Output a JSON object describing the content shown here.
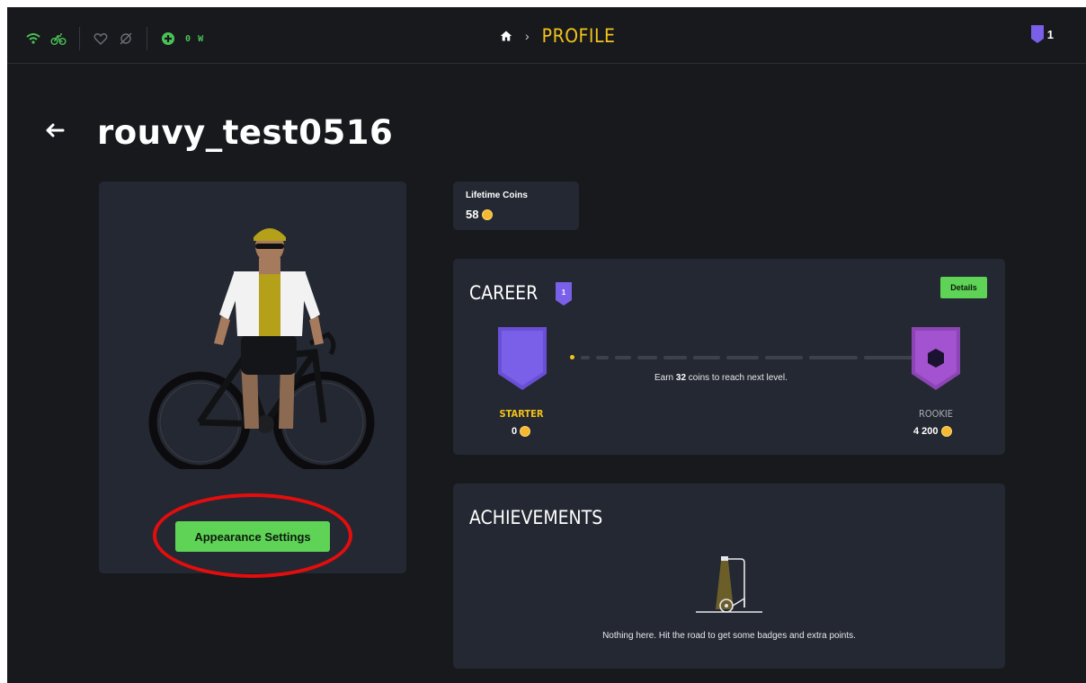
{
  "topbar": {
    "power_value": "0",
    "power_unit": "W",
    "breadcrumb_title": "PROFILE",
    "level_count": "1"
  },
  "profile": {
    "username": "rouvy_test0516"
  },
  "avatar": {
    "appearance_button_label": "Appearance Settings"
  },
  "coins": {
    "label": "Lifetime Coins",
    "value": "58"
  },
  "career": {
    "title": "CAREER",
    "level_badge": "1",
    "details_label": "Details",
    "progress_text_before": "Earn ",
    "progress_coins_needed": "32",
    "progress_text_after": " coins to reach next level.",
    "current_level": {
      "name": "STARTER",
      "coins": "0"
    },
    "next_level": {
      "name": "ROOKIE",
      "coins": "4 200"
    },
    "progress_fraction": 0
  },
  "achievements": {
    "title": "ACHIEVEMENTS",
    "empty_message": "Nothing here. Hit the road to get some badges and extra points."
  },
  "colors": {
    "accent_green": "#5ed356",
    "accent_yellow": "#f2c31b",
    "level_purple": "#7a5fe8",
    "highlight_red": "#e40d0d"
  },
  "icons": {
    "wifi": "wifi-icon",
    "bike": "bike-icon",
    "heart": "heart-rate-icon",
    "cadence": "cadence-icon",
    "power": "power-icon",
    "home": "home-icon",
    "back": "back-arrow-icon",
    "coin": "coin-icon",
    "shield": "level-shield-icon"
  }
}
